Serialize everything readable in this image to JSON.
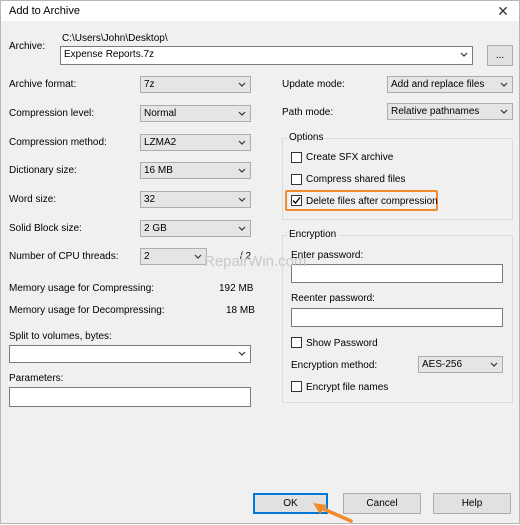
{
  "window": {
    "title": "Add to Archive"
  },
  "archive": {
    "label": "Archive:",
    "path": "C:\\Users\\John\\Desktop\\",
    "value": "Expense Reports.7z",
    "browse_label": "..."
  },
  "left": {
    "archive_format": {
      "label": "Archive format:",
      "value": "7z"
    },
    "compression_level": {
      "label": "Compression level:",
      "value": "Normal"
    },
    "compression_method": {
      "label": "Compression method:",
      "value": "LZMA2"
    },
    "dictionary_size": {
      "label": "Dictionary size:",
      "value": "16 MB"
    },
    "word_size": {
      "label": "Word size:",
      "value": "32"
    },
    "solid_block_size": {
      "label": "Solid Block size:",
      "value": "2 GB"
    },
    "cpu_threads": {
      "label": "Number of CPU threads:",
      "value": "2",
      "max": "/ 2"
    },
    "mem_compress": {
      "label": "Memory usage for Compressing:",
      "value": "192 MB"
    },
    "mem_decompress": {
      "label": "Memory usage for Decompressing:",
      "value": "18 MB"
    },
    "split_volumes": {
      "label": "Split to volumes, bytes:",
      "value": ""
    },
    "parameters": {
      "label": "Parameters:",
      "value": ""
    }
  },
  "right": {
    "update_mode": {
      "label": "Update mode:",
      "value": "Add and replace files"
    },
    "path_mode": {
      "label": "Path mode:",
      "value": "Relative pathnames"
    },
    "options": {
      "title": "Options",
      "sfx": "Create SFX archive",
      "shared": "Compress shared files",
      "delete": "Delete files after compression"
    },
    "encryption": {
      "title": "Encryption",
      "enter_password": "Enter password:",
      "reenter_password": "Reenter password:",
      "show_password": "Show Password",
      "method_label": "Encryption method:",
      "method_value": "AES-256",
      "encrypt_names": "Encrypt file names"
    }
  },
  "buttons": {
    "ok": "OK",
    "cancel": "Cancel",
    "help": "Help"
  },
  "watermark": "RepairWin.com"
}
